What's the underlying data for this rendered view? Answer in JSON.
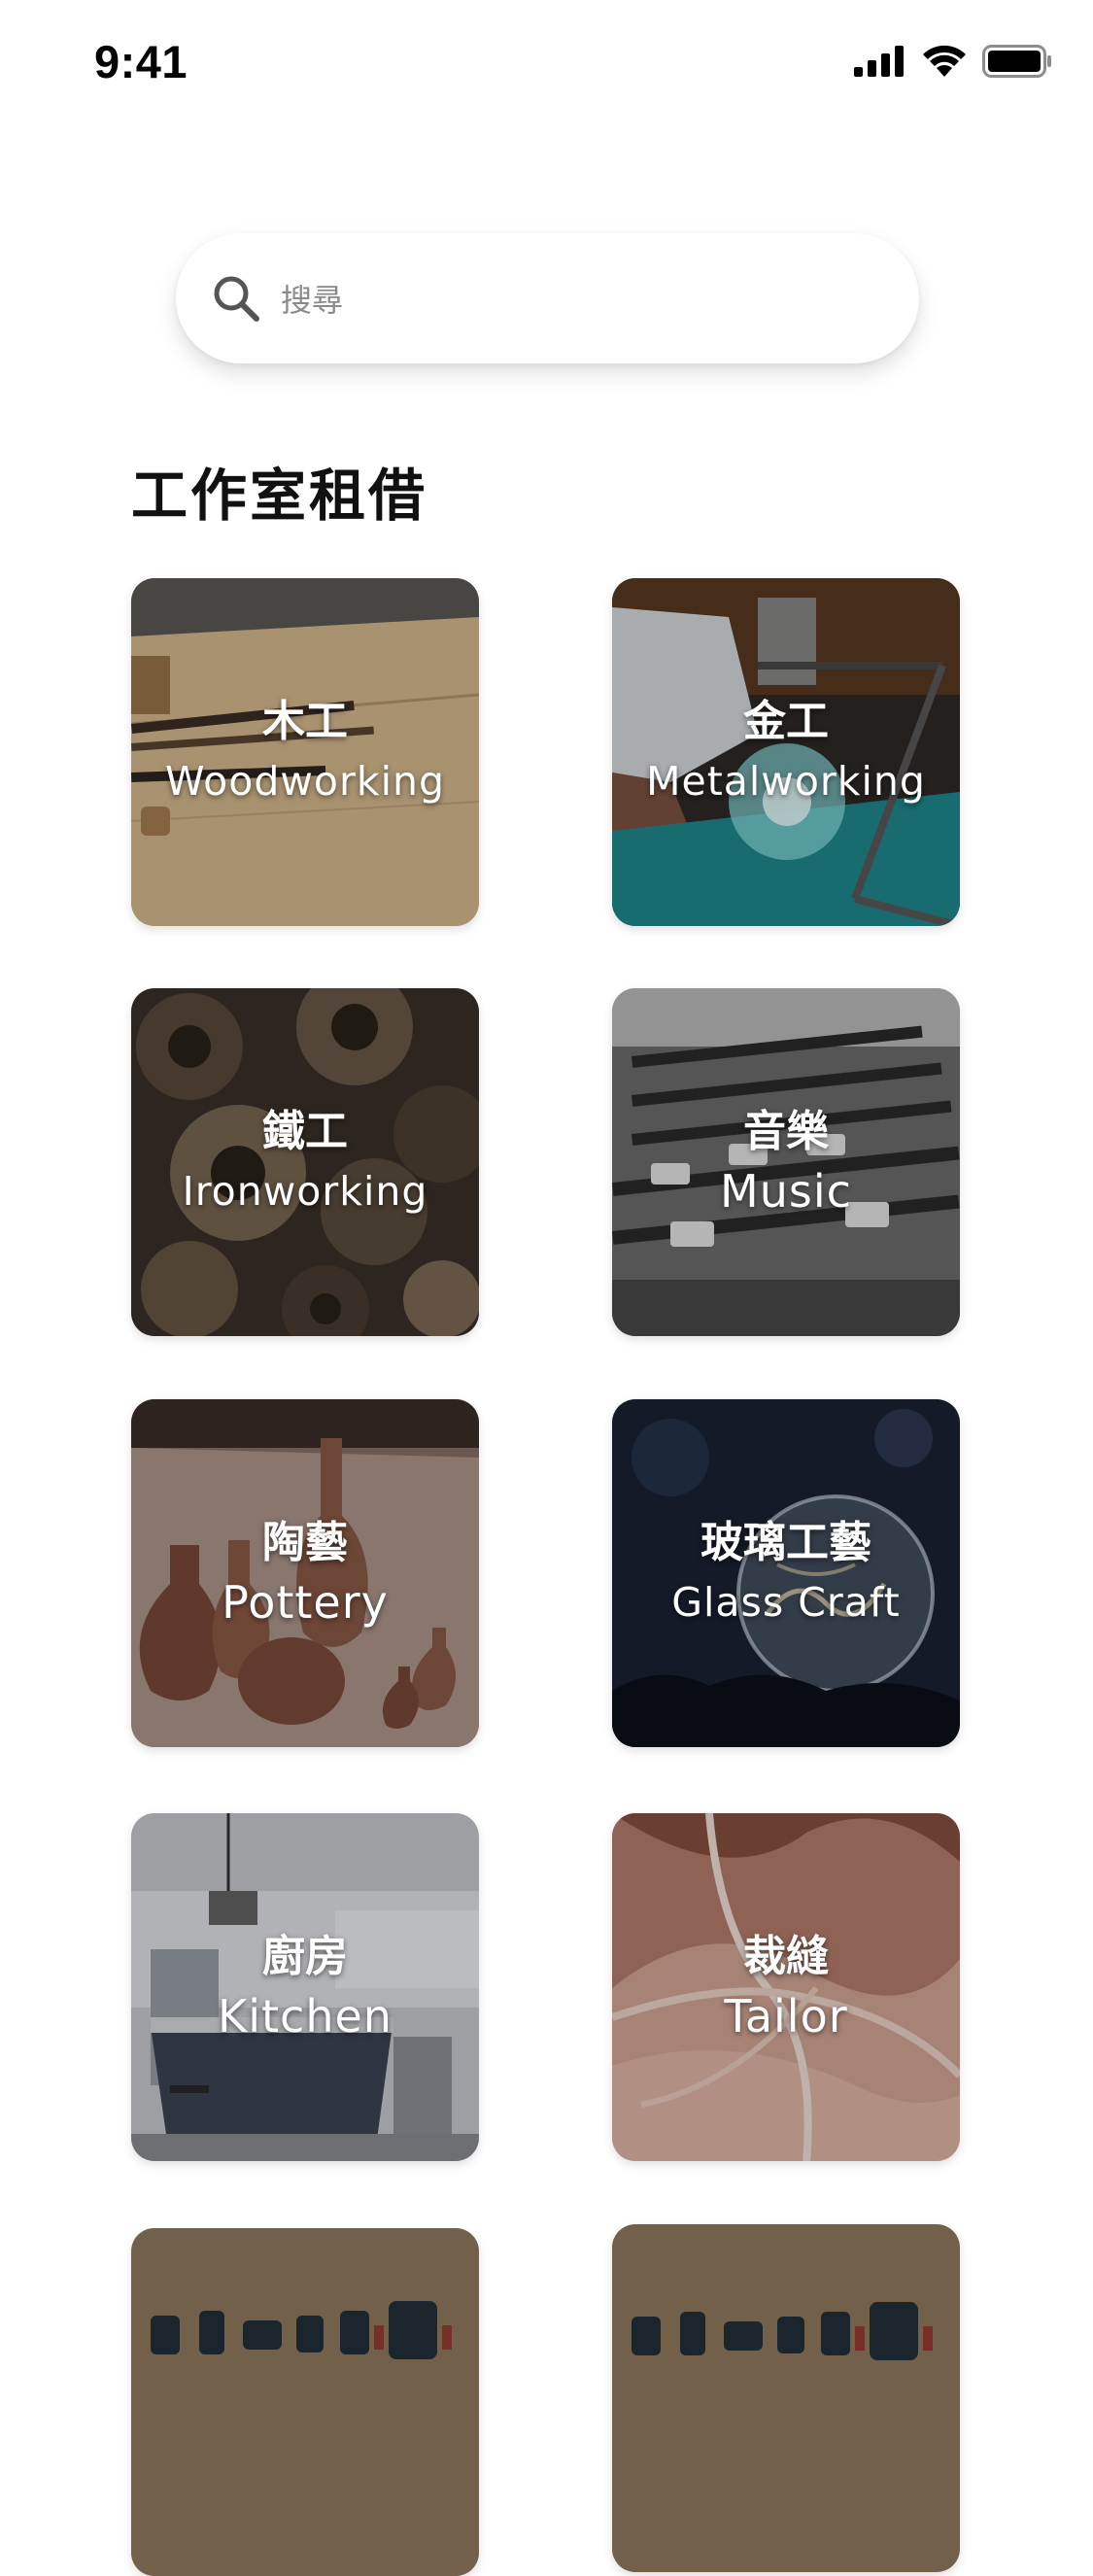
{
  "status_bar": {
    "time": "9:41",
    "icons": [
      "signal-icon",
      "wifi-icon",
      "battery-icon"
    ]
  },
  "search": {
    "placeholder": "搜尋",
    "icon": "search-icon"
  },
  "section": {
    "title": "工作室租借"
  },
  "categories": [
    {
      "zh": "木工",
      "en": "Woodworking"
    },
    {
      "zh": "金工",
      "en": "Metalworking"
    },
    {
      "zh": "鐵工",
      "en": "Ironworking"
    },
    {
      "zh": "音樂",
      "en": "Music"
    },
    {
      "zh": "陶藝",
      "en": "Pottery"
    },
    {
      "zh": "玻璃工藝",
      "en": "Glass Craft"
    },
    {
      "zh": "廚房",
      "en": "Kitchen"
    },
    {
      "zh": "裁縫",
      "en": "Tailor"
    },
    {
      "zh": "",
      "en": ""
    },
    {
      "zh": "",
      "en": ""
    }
  ]
}
